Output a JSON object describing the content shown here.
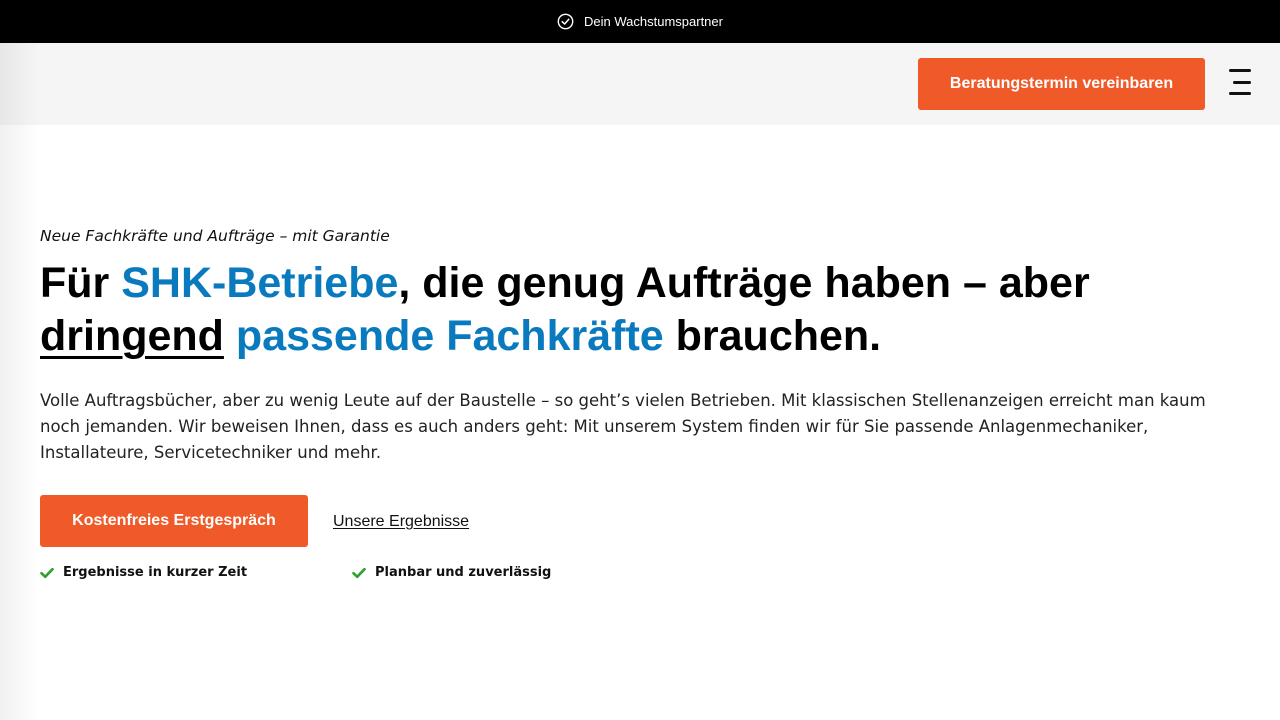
{
  "topbar": {
    "icon": "check-circle-icon",
    "text": "Dein Wachstumspartner"
  },
  "header": {
    "cta_label": "Beratungstermin vereinbaren",
    "menu_icon": "hamburger-menu-icon"
  },
  "hero": {
    "eyebrow": "Neue Fachkräfte und Aufträge – mit Garantie",
    "headline": {
      "part1": "Für ",
      "highlight1": "SHK-Betriebe",
      "part2": ", die genug Aufträge haben – aber ",
      "underlined": "dringend",
      "part3": " ",
      "highlight2": "passende Fachkräfte",
      "part4": " brauchen."
    },
    "lead": "Volle Auftragsbücher, aber zu wenig Leute auf der Baustelle – so geht’s vielen Betrieben. Mit klassischen Stellenanzeigen erreicht man kaum noch jemanden. Wir beweisen Ihnen, dass es auch anders geht: Mit unserem System finden wir für Sie passende Anlagenmechaniker, Installateure, Servicetechniker und mehr.",
    "primary_cta": "Kostenfreies Erstgespräch",
    "secondary_link": "Unsere Ergebnisse",
    "features": [
      {
        "icon": "checkmark-icon",
        "label": "Ergebnisse in kurzer Zeit"
      },
      {
        "icon": "checkmark-icon",
        "label": "Planbar und zuverlässig"
      }
    ]
  },
  "colors": {
    "accent": "#f05a28",
    "highlight": "#0a7abf",
    "topbar_bg": "#000000",
    "header_bg": "#f5f5f5",
    "check_green": "#2ea02e"
  }
}
